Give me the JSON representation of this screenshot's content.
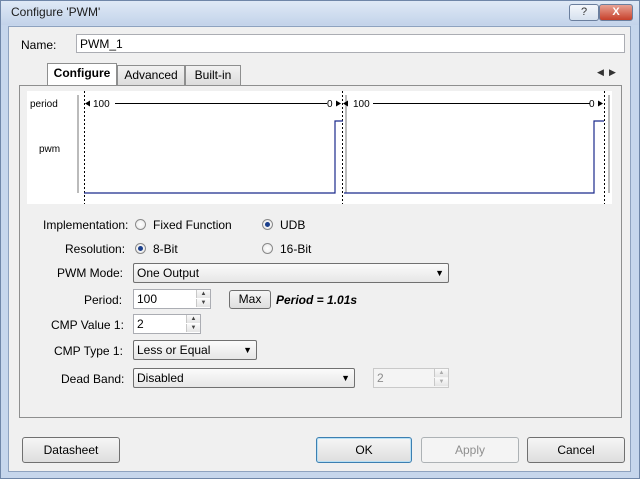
{
  "window": {
    "title": "Configure 'PWM'",
    "help_label": "?",
    "close_label": "X"
  },
  "name_field": {
    "label": "Name:",
    "value": "PWM_1"
  },
  "tabs": [
    {
      "label": "Configure"
    },
    {
      "label": "Advanced"
    },
    {
      "label": "Built-in"
    }
  ],
  "tab_scroll": {
    "left": "◀",
    "right": "▶"
  },
  "waveform": {
    "period_label": "period",
    "pwm_label": "pwm",
    "period_start": "100",
    "period_end": "0",
    "period_start_2": "100",
    "period_end_2": "0"
  },
  "implementation": {
    "label": "Implementation:",
    "options": [
      "Fixed Function",
      "UDB"
    ],
    "selected": "UDB"
  },
  "resolution": {
    "label": "Resolution:",
    "options": [
      "8-Bit",
      "16-Bit"
    ],
    "selected": "8-Bit"
  },
  "pwm_mode": {
    "label": "PWM Mode:",
    "value": "One Output"
  },
  "period": {
    "label": "Period:",
    "value": "100",
    "max_label": "Max",
    "computed": "Period = 1.01s"
  },
  "cmp_value1": {
    "label": "CMP Value 1:",
    "value": "2"
  },
  "cmp_type1": {
    "label": "CMP Type 1:",
    "value": "Less or Equal"
  },
  "dead_band": {
    "label": "Dead Band:",
    "value": "Disabled",
    "count_value": "2"
  },
  "footer": {
    "datasheet": "Datasheet",
    "ok": "OK",
    "apply": "Apply",
    "cancel": "Cancel"
  },
  "colors": {
    "title_bg": "#c8d8ee",
    "pwm_trace": "#1b2a8c",
    "dialog_bg": "#f0f0f0"
  }
}
